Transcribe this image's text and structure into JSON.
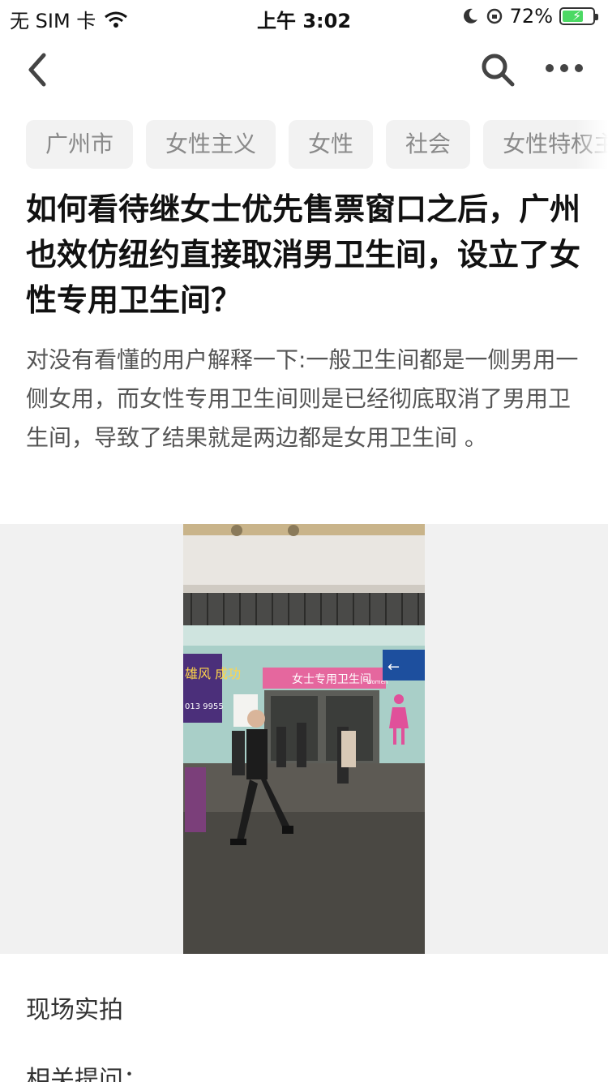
{
  "status_bar": {
    "carrier": "无 SIM 卡",
    "time": "上午 3:02",
    "battery": "72%",
    "icons": [
      "wifi-icon",
      "moon-icon",
      "rotation-lock-icon",
      "battery-icon"
    ]
  },
  "navbar": {
    "icons": [
      "back-chevron-icon",
      "search-icon",
      "more-dots-icon"
    ]
  },
  "tags": [
    "广州市",
    "女性主义",
    "女性",
    "社会",
    "女性特权主"
  ],
  "question": {
    "title": "如何看待继女士优先售票窗口之后，广州也效仿纽约直接取消男卫生间，设立了女性专用卫生间？",
    "description": "对没有看懂的用户解释一下:一般卫生间都是一侧男用一侧女用，而女性专用卫生间则是已经彻底取消了男用卫生间，导致了结果就是两边都是女用卫生间 。"
  },
  "photo": {
    "sign_text": "女士专用卫生间",
    "sign_sub": "Women",
    "ad_text": "雄风 成功",
    "ad_phone": "013 9955"
  },
  "caption": "现场实拍",
  "related_label": "相关提问："
}
